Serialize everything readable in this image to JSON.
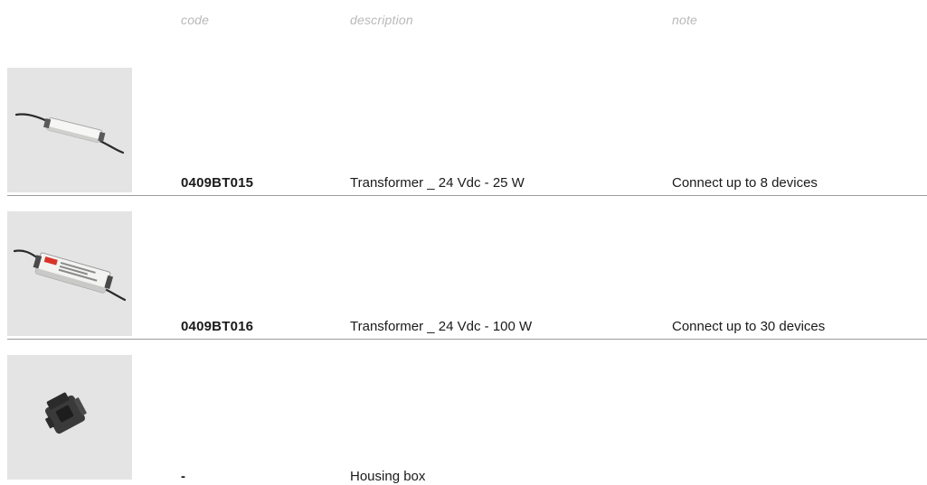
{
  "header": {
    "code": "code",
    "description": "description",
    "note": "note"
  },
  "rows": [
    {
      "image_icon": "led-driver-slim-icon",
      "code": "0409BT015",
      "description": "Transformer _ 24 Vdc - 25 W",
      "note": "Connect up to 8 devices"
    },
    {
      "image_icon": "led-driver-large-icon",
      "code": "0409BT016",
      "description": "Transformer _ 24 Vdc - 100 W",
      "note": "Connect up to 30 devices"
    },
    {
      "image_icon": "housing-box-icon",
      "code": "-",
      "description": "Housing box",
      "note": ""
    }
  ]
}
